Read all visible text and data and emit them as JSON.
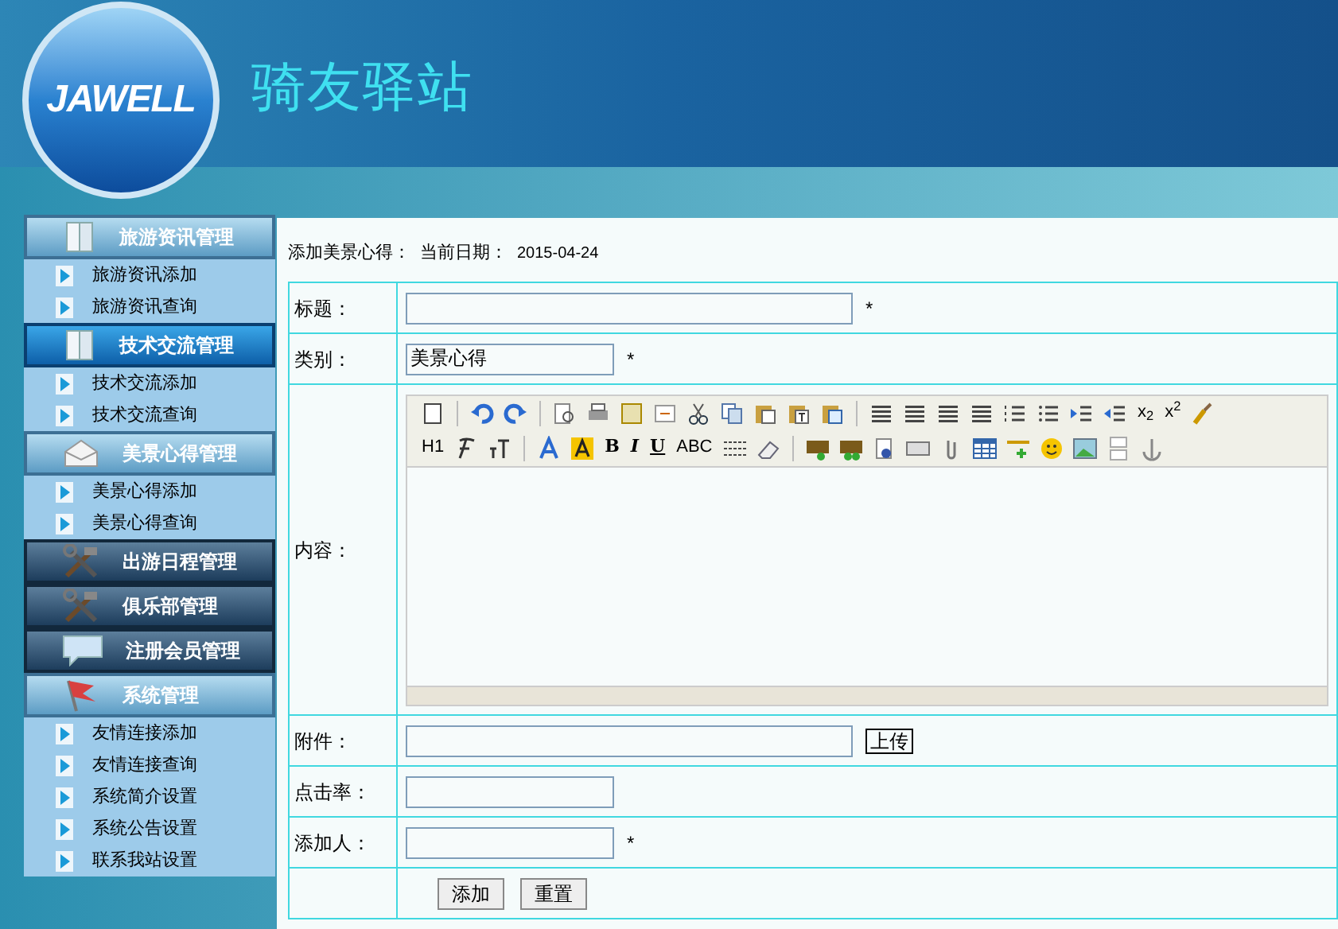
{
  "header": {
    "logo_text": "JAWELL",
    "site_title": "骑友驿站"
  },
  "sidebar": {
    "groups": [
      {
        "label": "旅游资讯管理",
        "expanded": true,
        "selected": false,
        "items": [
          "旅游资讯添加",
          "旅游资讯查询"
        ]
      },
      {
        "label": "技术交流管理",
        "expanded": true,
        "selected": true,
        "items": [
          "技术交流添加",
          "技术交流查询"
        ]
      },
      {
        "label": "美景心得管理",
        "expanded": true,
        "selected": false,
        "items": [
          "美景心得添加",
          "美景心得查询"
        ]
      },
      {
        "label": "出游日程管理",
        "expanded": false,
        "selected": false
      },
      {
        "label": "俱乐部管理",
        "expanded": false,
        "selected": false
      },
      {
        "label": "注册会员管理",
        "expanded": false,
        "selected": false
      },
      {
        "label": "系统管理",
        "expanded": true,
        "selected": false,
        "items": [
          "友情连接添加",
          "友情连接查询",
          "系统简介设置",
          "系统公告设置",
          "联系我站设置"
        ]
      }
    ]
  },
  "form": {
    "caption": "添加美景心得：",
    "date_label": "当前日期：",
    "date": "2015-04-24",
    "rows": [
      {
        "kind": "text",
        "label": "标题：",
        "value": "",
        "wide": true,
        "required": "*"
      },
      {
        "kind": "text",
        "label": "类别：",
        "value": "美景心得",
        "wide": false,
        "required": "*"
      },
      {
        "kind": "editor",
        "label": "内容：",
        "toolbar_labels": [
          "x$_{2}$",
          "x$^{2}$",
          "H1",
          "B",
          "I",
          "U",
          "ABC"
        ]
      },
      {
        "kind": "upload",
        "label": "附件：",
        "value": "",
        "button": "上传"
      },
      {
        "kind": "text",
        "label": "点击率：",
        "value": "",
        "wide": false,
        "required": ""
      },
      {
        "kind": "text",
        "label": "添加人：",
        "value": "",
        "wide": false,
        "required": "*"
      },
      {
        "kind": "buttons",
        "buttons": [
          "添加",
          "重置"
        ]
      }
    ]
  }
}
